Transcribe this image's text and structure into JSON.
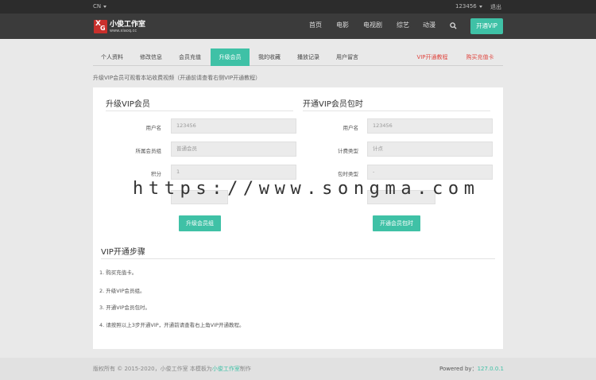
{
  "topbar": {
    "lang": "CN",
    "user": "123456",
    "logout": "退出"
  },
  "logo": {
    "mark_x": "X",
    "mark_g": "G",
    "title": "小俊工作室",
    "subtitle": "www.xiaoq.cc"
  },
  "nav": {
    "items": [
      "首页",
      "电影",
      "电视剧",
      "综艺",
      "动漫"
    ],
    "open_vip": "开通VIP"
  },
  "tabs": {
    "items": [
      "个人资料",
      "修改信息",
      "会员充值",
      "升级会员",
      "我的收藏",
      "播放记录",
      "用户留言"
    ],
    "active_index": 3,
    "right": [
      "VIP开通教程",
      "购买充值卡"
    ]
  },
  "notice": "升级VIP会员可观看本站收费视频（开通前请查看右侧VIP开通教程）",
  "upgrade": {
    "title": "升级VIP会员",
    "fields": [
      {
        "label": "用户名",
        "value": "123456"
      },
      {
        "label": "所属会员组",
        "value": "普通会员"
      },
      {
        "label": "积分",
        "value": "1"
      }
    ],
    "button": "升级会员组"
  },
  "package": {
    "title": "开通VIP会员包时",
    "fields": [
      {
        "label": "用户名",
        "value": "123456"
      },
      {
        "label": "计费类型",
        "value": "计点"
      },
      {
        "label": "包时类型",
        "value": "-"
      }
    ],
    "button": "开通会员包时"
  },
  "steps": {
    "title": "VIP开通步骤",
    "items": [
      "1. 购买充值卡。",
      "2. 升级VIP会员组。",
      "3. 开通VIP会员包时。",
      "4. 请按照以上3步开通VIP，开通前请查看右上角VIP开通教程。"
    ]
  },
  "watermark": "https://www.songma.com",
  "footer": {
    "copyright": "版权所有 © 2015-2020，小俊工作室 本模板为",
    "link": "小俊工作室",
    "suffix": "制作",
    "powered_label": "Powered by：",
    "powered_value": "127.0.0.1"
  },
  "colors": {
    "accent": "#3fc1a6",
    "red": "#e0463f",
    "topbar": "#2c2c2c",
    "header": "#3b3b3b"
  }
}
